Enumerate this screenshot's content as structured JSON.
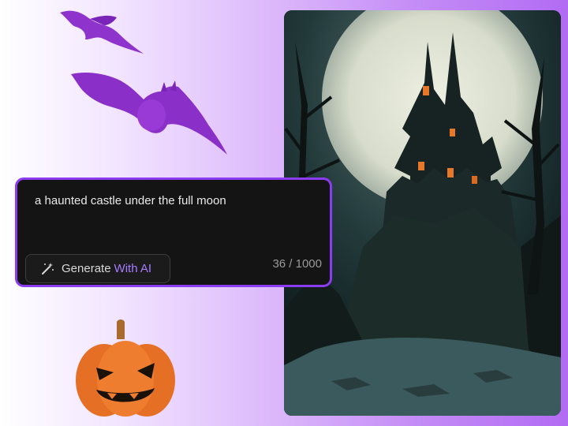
{
  "prompt": {
    "text": "a haunted castle under the full moon",
    "char_count": "36 / 1000"
  },
  "generate_button": {
    "label": "Generate",
    "accent": "With AI",
    "icon": "magic-wand-icon"
  },
  "decorations": {
    "bats": [
      "bat-icon",
      "bat-icon"
    ],
    "pumpkin": "jack-o-lantern-icon"
  },
  "image_preview": {
    "subject": "haunted castle illustration"
  },
  "colors": {
    "accent": "#8b3cf0",
    "accent_text": "#a77bff",
    "card_bg": "#141414",
    "bat": "#8a2fc8",
    "pumpkin": "#e8722a"
  }
}
